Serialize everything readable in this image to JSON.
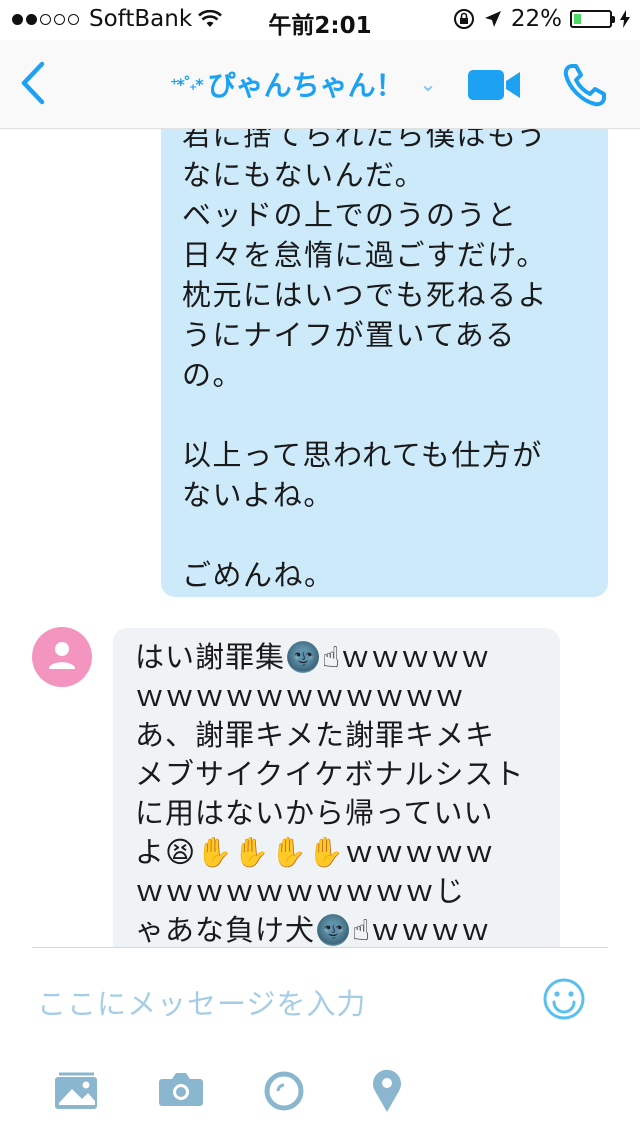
{
  "status_bar": {
    "carrier": "SoftBank",
    "time": "午前2:01",
    "battery": "22%",
    "battery_level": 0.22,
    "signal_dots_on": 2,
    "signal_dots_total": 5
  },
  "header": {
    "contact_name": "ぴゃんちゃん！",
    "sparkle_glyph": "⁺*˚₊*",
    "chevron": "⌄"
  },
  "messages": {
    "outgoing_text": "君に捨てられたら僕はもう\nなにもないんだ。\nベッドの上でのうのうと\n日々を怠惰に過ごすだけ。\n枕元にはいつでも死ねるよ\nうにナイフが置いてある\nの。\n\n以上って思われても仕方が\nないよね。\n\nごめんね。",
    "incoming_text": "はい謝罪集🌚☝ｗｗｗｗｗ\nｗｗｗｗｗｗｗｗｗｗｗ\nあ、謝罪キメた謝罪キメキ\nメブサイクイケボナルシスト\nに用はないから帰っていい\nよ😫✋✋✋✋ｗｗｗｗｗ\nｗｗｗｗｗｗｗｗｗｗじ\nゃあな負け犬🌚☝ｗｗｗｗ"
  },
  "composer": {
    "placeholder": "ここにメッセージを入力"
  },
  "colors": {
    "accent": "#1da1f2",
    "outgoing_bubble": "#cdeafb",
    "incoming_bubble": "#f0f3f5",
    "avatar": "#f495bf",
    "toolbar_icons": "#8bb6cf"
  }
}
